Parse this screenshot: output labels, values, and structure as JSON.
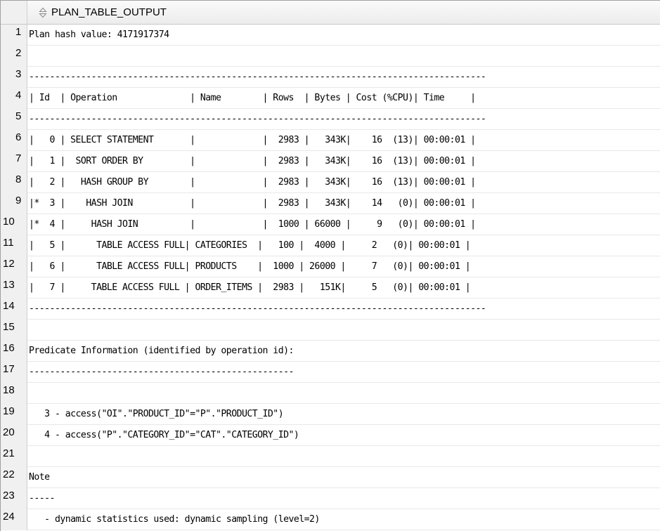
{
  "column_header": "PLAN_TABLE_OUTPUT",
  "sort_icon": "sort-arrows-icon",
  "rows": [
    {
      "num": "1",
      "text": "Plan hash value: 4171917374"
    },
    {
      "num": "2",
      "text": ""
    },
    {
      "num": "3",
      "text": "----------------------------------------------------------------------------------------"
    },
    {
      "num": "4",
      "text": "| Id  | Operation              | Name        | Rows  | Bytes | Cost (%CPU)| Time     |"
    },
    {
      "num": "5",
      "text": "----------------------------------------------------------------------------------------"
    },
    {
      "num": "6",
      "text": "|   0 | SELECT STATEMENT       |             |  2983 |   343K|    16  (13)| 00:00:01 |"
    },
    {
      "num": "7",
      "text": "|   1 |  SORT ORDER BY         |             |  2983 |   343K|    16  (13)| 00:00:01 |"
    },
    {
      "num": "8",
      "text": "|   2 |   HASH GROUP BY        |             |  2983 |   343K|    16  (13)| 00:00:01 |"
    },
    {
      "num": "9",
      "text": "|*  3 |    HASH JOIN           |             |  2983 |   343K|    14   (0)| 00:00:01 |"
    },
    {
      "num": "10",
      "text": "|*  4 |     HASH JOIN          |             |  1000 | 66000 |     9   (0)| 00:00:01 |"
    },
    {
      "num": "11",
      "text": "|   5 |      TABLE ACCESS FULL| CATEGORIES  |   100 |  4000 |     2   (0)| 00:00:01 |"
    },
    {
      "num": "12",
      "text": "|   6 |      TABLE ACCESS FULL| PRODUCTS    |  1000 | 26000 |     7   (0)| 00:00:01 |"
    },
    {
      "num": "13",
      "text": "|   7 |     TABLE ACCESS FULL | ORDER_ITEMS |  2983 |   151K|     5   (0)| 00:00:01 |"
    },
    {
      "num": "14",
      "text": "----------------------------------------------------------------------------------------"
    },
    {
      "num": "15",
      "text": ""
    },
    {
      "num": "16",
      "text": "Predicate Information (identified by operation id):"
    },
    {
      "num": "17",
      "text": "---------------------------------------------------"
    },
    {
      "num": "18",
      "text": ""
    },
    {
      "num": "19",
      "text": "   3 - access(\"OI\".\"PRODUCT_ID\"=\"P\".\"PRODUCT_ID\")"
    },
    {
      "num": "20",
      "text": "   4 - access(\"P\".\"CATEGORY_ID\"=\"CAT\".\"CATEGORY_ID\")"
    },
    {
      "num": "21",
      "text": ""
    },
    {
      "num": "22",
      "text": "Note"
    },
    {
      "num": "23",
      "text": "-----"
    },
    {
      "num": "24",
      "text": "   - dynamic statistics used: dynamic sampling (level=2)"
    }
  ]
}
